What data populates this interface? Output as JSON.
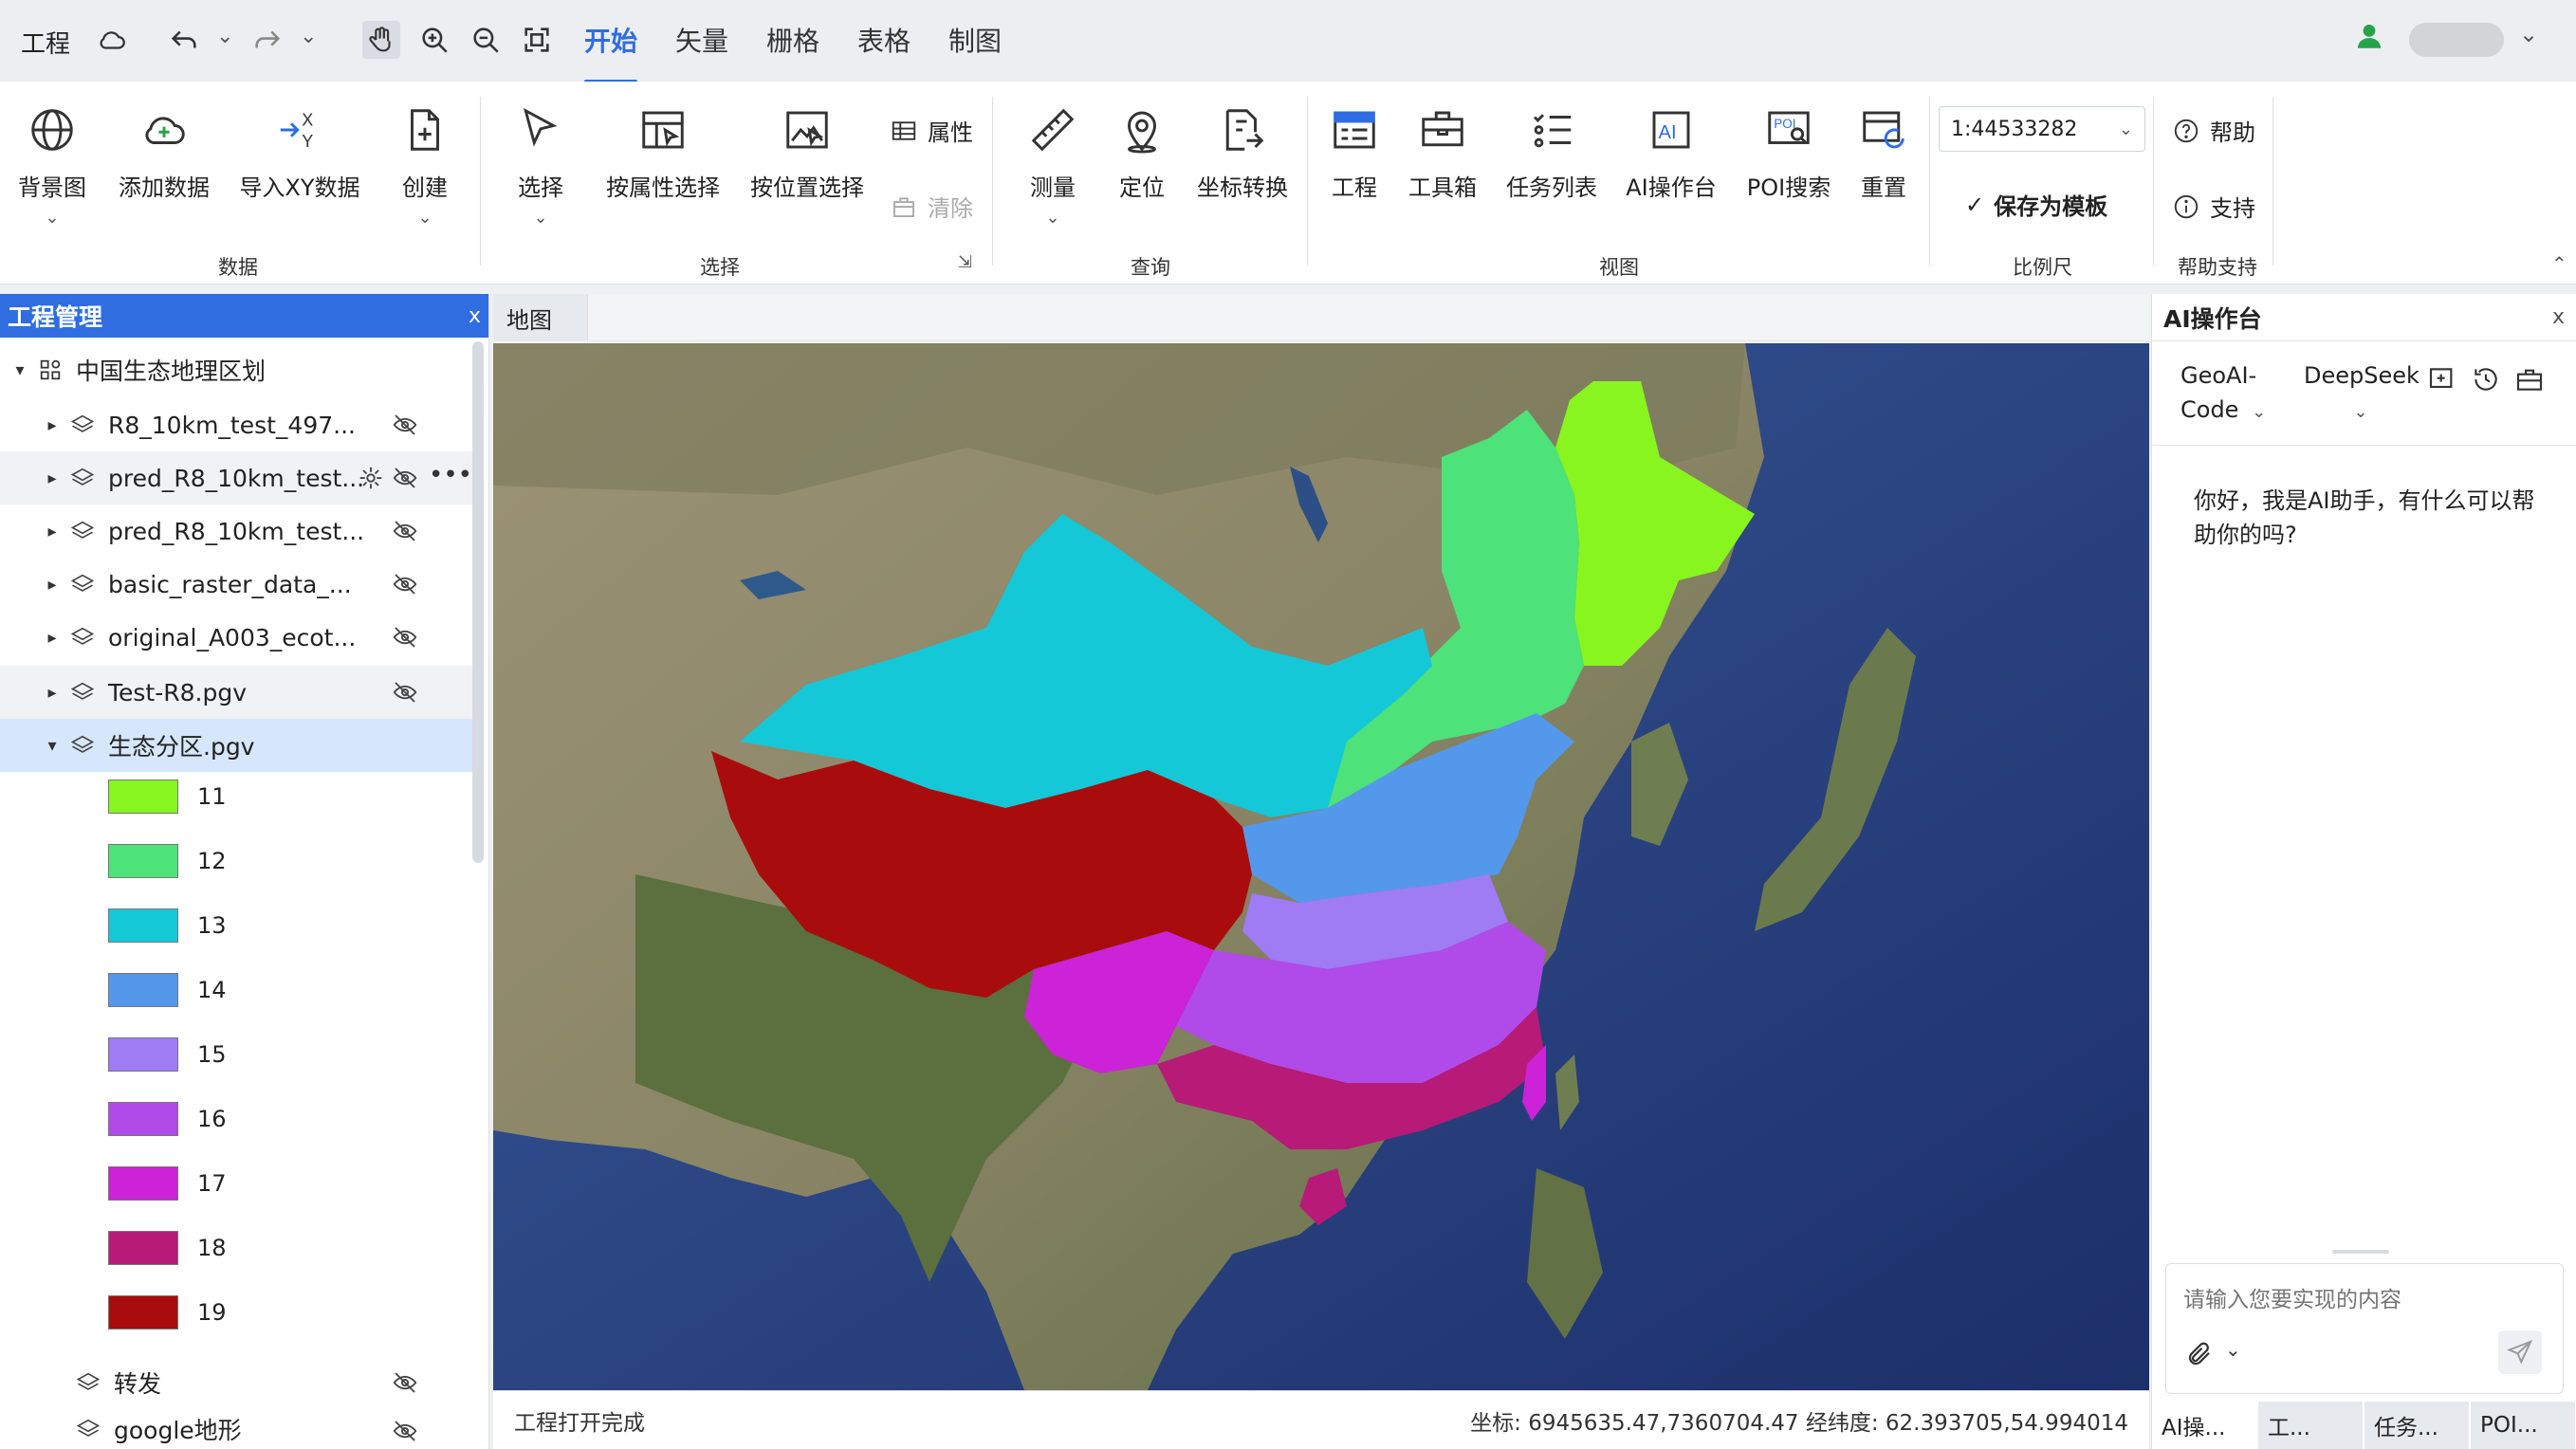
{
  "topbar": {
    "project_label": "工程",
    "tabs": [
      {
        "label": "开始",
        "active": true
      },
      {
        "label": "矢量",
        "active": false
      },
      {
        "label": "栅格",
        "active": false
      },
      {
        "label": "表格",
        "active": false
      },
      {
        "label": "制图",
        "active": false
      }
    ],
    "icons": [
      "cloud-icon",
      "undo-icon",
      "redo-icon",
      "pan-hand-icon",
      "zoom-in-icon",
      "zoom-out-icon",
      "full-extent-icon",
      "user-icon"
    ]
  },
  "ribbon": {
    "data_group": {
      "label": "数据",
      "buttons": [
        {
          "label": "背景图",
          "icon": "globe-icon"
        },
        {
          "label": "添加数据",
          "icon": "cloud-add-icon"
        },
        {
          "label": "导入XY数据",
          "icon": "xy-import-icon"
        },
        {
          "label": "创建",
          "icon": "new-file-icon"
        }
      ]
    },
    "select_group": {
      "label": "选择",
      "buttons": [
        {
          "label": "选择",
          "icon": "cursor-icon"
        },
        {
          "label": "按属性选择",
          "icon": "attr-select-icon"
        },
        {
          "label": "按位置选择",
          "icon": "location-select-icon"
        }
      ],
      "small_buttons": [
        {
          "label": "属性",
          "icon": "table-icon",
          "enabled": true
        },
        {
          "label": "清除",
          "icon": "clear-icon",
          "enabled": false
        }
      ]
    },
    "query_group": {
      "label": "查询",
      "buttons": [
        {
          "label": "测量",
          "icon": "ruler-icon"
        },
        {
          "label": "定位",
          "icon": "locate-icon"
        },
        {
          "label": "坐标转换",
          "icon": "coord-convert-icon"
        }
      ]
    },
    "view_group": {
      "label": "视图",
      "buttons": [
        {
          "label": "工程",
          "icon": "project-window-icon"
        },
        {
          "label": "工具箱",
          "icon": "toolbox-icon"
        },
        {
          "label": "任务列表",
          "icon": "task-list-icon"
        },
        {
          "label": "AI操作台",
          "icon": "ai-console-icon"
        },
        {
          "label": "POI搜索",
          "icon": "poi-search-icon"
        },
        {
          "label": "重置",
          "icon": "reset-icon"
        }
      ]
    },
    "scale_group": {
      "label": "比例尺",
      "scale_value": "1:44533282",
      "save_template": "保存为模板"
    },
    "help_group": {
      "label": "帮助支持",
      "buttons": [
        {
          "label": "帮助",
          "icon": "help-icon"
        },
        {
          "label": "支持",
          "icon": "info-icon"
        }
      ]
    }
  },
  "left_panel": {
    "title": "工程管理",
    "close": "x",
    "root": "中国生态地理区划",
    "layers": [
      {
        "name": "R8_10km_test_497..."
      },
      {
        "name": "pred_R8_10km_test..."
      },
      {
        "name": "pred_R8_10km_test..."
      },
      {
        "name": "basic_raster_data_..."
      },
      {
        "name": "original_A003_ecot..."
      },
      {
        "name": "Test-R8.pgv"
      },
      {
        "name": "生态分区.pgv"
      }
    ],
    "legend": [
      {
        "label": "11",
        "color": "#88f51f"
      },
      {
        "label": "12",
        "color": "#4de27a"
      },
      {
        "label": "13",
        "color": "#14c8d8"
      },
      {
        "label": "14",
        "color": "#5498ec"
      },
      {
        "label": "15",
        "color": "#9f7bf4"
      },
      {
        "label": "16",
        "color": "#b04ae8"
      },
      {
        "label": "17",
        "color": "#cc22d8"
      },
      {
        "label": "18",
        "color": "#b81a78"
      },
      {
        "label": "19",
        "color": "#a80c0c"
      }
    ],
    "extra_layers": [
      {
        "name": "转发"
      },
      {
        "name": "google地形"
      }
    ]
  },
  "map": {
    "tab_label": "地图",
    "status_text": "工程打开完成",
    "coords_text": "坐标: 6945635.47,7360704.47 经纬度: 62.393705,54.994014"
  },
  "right_panel": {
    "title": "AI操作台",
    "close": "x",
    "model_1": "GeoAI-Code",
    "model_2": "DeepSeek",
    "message": "你好，我是AI助手，有什么可以帮助你的吗?",
    "input_placeholder": "请输入您要实现的内容",
    "bottom_tabs": [
      "AI操...",
      "工...",
      "任务...",
      "POI..."
    ]
  },
  "colors": {
    "accent": "#2f6de1",
    "selected_row": "#d6e6fb"
  }
}
